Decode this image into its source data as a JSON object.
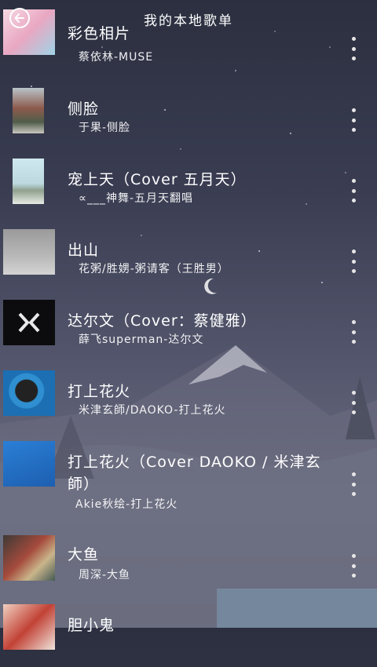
{
  "header": {
    "title": "我的本地歌单"
  },
  "songs": [
    {
      "title": "彩色相片",
      "subtitle": "蔡依林-MUSE"
    },
    {
      "title": "侧脸",
      "subtitle": "于果-侧脸"
    },
    {
      "title": "宠上天（Cover 五月天）",
      "subtitle": "∝___神舞-五月天翻唱"
    },
    {
      "title": "出山",
      "subtitle": "花粥/胜娚-粥请客（王胜男）"
    },
    {
      "title": "达尔文（Cover：蔡健雅）",
      "subtitle": "薛飞superman-达尔文"
    },
    {
      "title": "打上花火",
      "subtitle": "米津玄師/DAOKO-打上花火"
    },
    {
      "title": "打上花火（Cover DAOKO / 米津玄",
      "title_line2": "師）",
      "subtitle": "Akie秋绘-打上花火"
    },
    {
      "title": "大鱼",
      "subtitle": "周深-大鱼"
    },
    {
      "title": "胆小鬼",
      "subtitle": ""
    }
  ]
}
